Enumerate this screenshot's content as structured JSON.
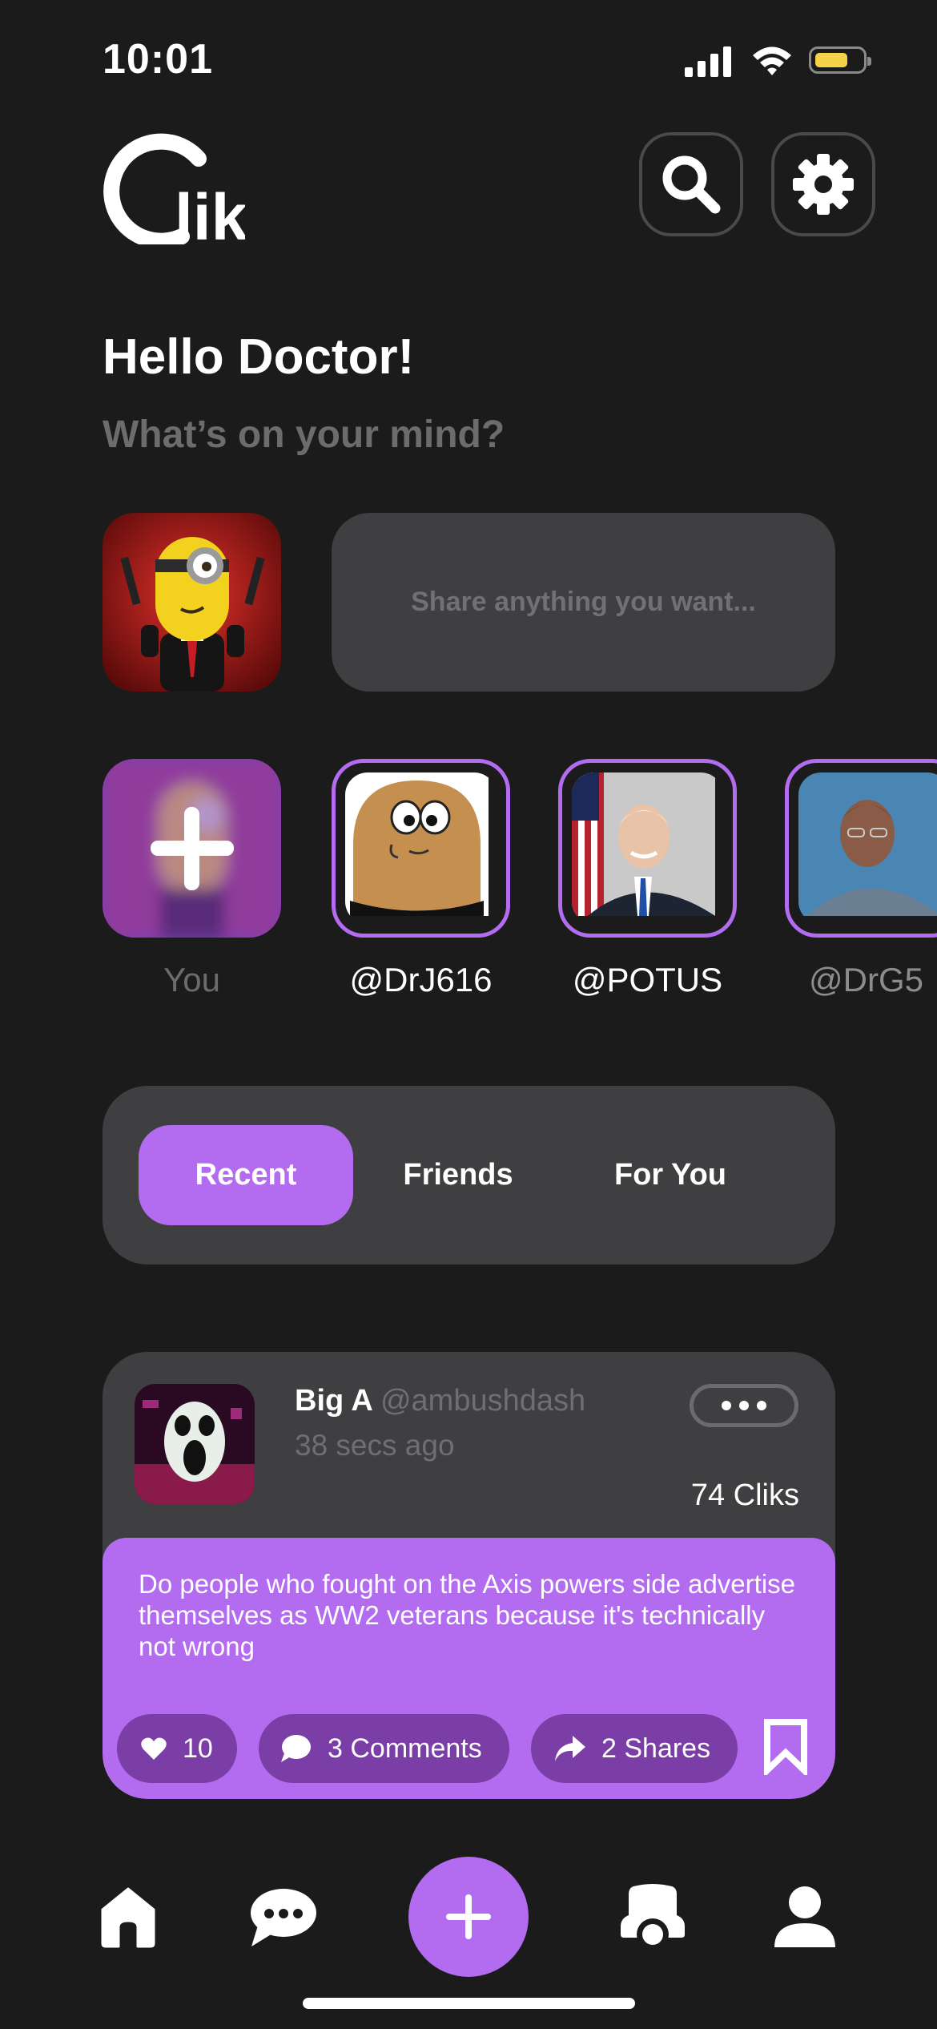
{
  "status_bar": {
    "time": "10:01"
  },
  "header": {
    "logo_text": "lik"
  },
  "greeting": {
    "title": "Hello Doctor!",
    "subtitle": "What’s on your mind?"
  },
  "composer": {
    "placeholder": "Share anything you want..."
  },
  "stories": [
    {
      "name": "You"
    },
    {
      "name": "@DrJ616"
    },
    {
      "name": "@POTUS"
    },
    {
      "name": "@DrG5"
    }
  ],
  "tabs": [
    {
      "label": "Recent",
      "active": true
    },
    {
      "label": "Friends",
      "active": false
    },
    {
      "label": "For You",
      "active": false
    }
  ],
  "post": {
    "author": "Big A",
    "handle": "@ambushdash",
    "time": "38 secs ago",
    "cliks": "74 Cliks",
    "text": "Do people who fought on the Axis powers side advertise themselves as WW2 veterans because it's technically not wrong",
    "likes": "10",
    "comments": "3 Comments",
    "shares": "2 Shares"
  },
  "colors": {
    "accent": "#b36cf0",
    "background": "#1b1b1c",
    "card": "#3f3f41",
    "pill": "#7a3ea6"
  }
}
